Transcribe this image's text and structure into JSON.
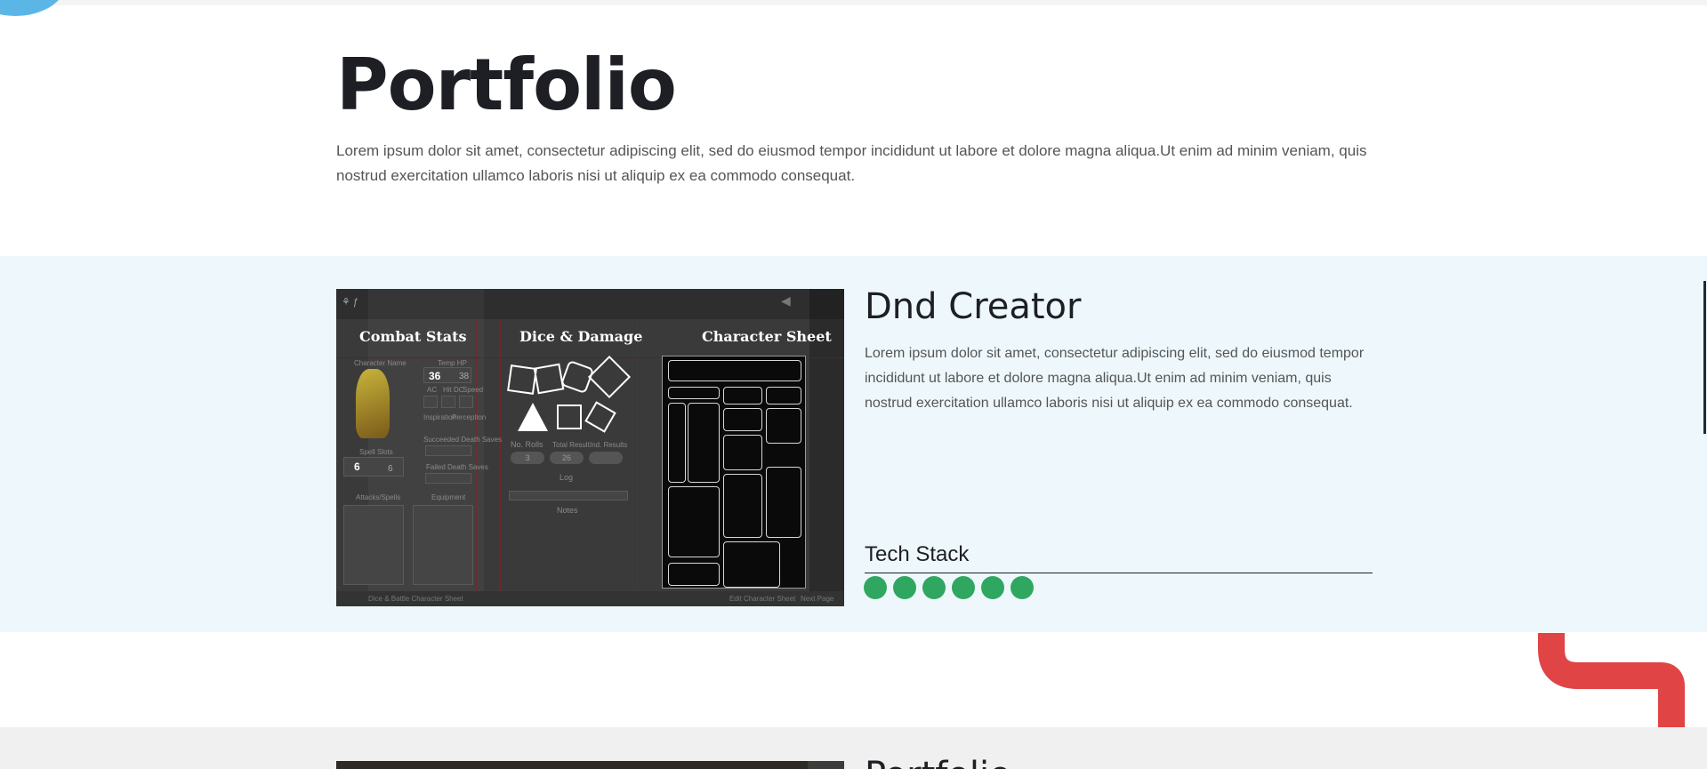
{
  "header": {
    "title": "Portfolio",
    "intro": "Lorem ipsum dolor sit amet, consectetur adipiscing elit, sed do eiusmod tempor incididunt ut labore et dolore magna aliqua.Ut enim ad minim veniam, quis nostrud exercitation ullamco laboris nisi ut aliquip ex ea commodo consequat."
  },
  "projects": [
    {
      "title": "Dnd Creator",
      "description": "Lorem ipsum dolor sit amet, consectetur adipiscing elit, sed do eiusmod tempor incididunt ut labore et dolore magna aliqua.Ut enim ad minim veniam, quis nostrud exercitation ullamco laboris nisi ut aliquip ex ea commodo consequat.",
      "tech_stack_label": "Tech Stack",
      "tech_stack_count": 6,
      "screenshot": {
        "panels": [
          "Combat Stats",
          "Dice & Damage",
          "Character Sheet"
        ],
        "labels": {
          "character_name": "Character Name",
          "temp_hp": "Temp HP",
          "spell_slots": "Spell Slots",
          "attacks_spells": "Attacks/Spells",
          "equipment": "Equipment",
          "no_rolls": "No. Rolls",
          "total_result": "Total Result",
          "ind_results": "Ind. Results",
          "log": "Log",
          "notes": "Notes",
          "ac": "AC",
          "hit_dc": "Hit DC",
          "speed": "Speed",
          "inspiration": "Inspiration",
          "perception": "Perception",
          "succeeded_death_saves": "Succeeded Death Saves",
          "failed_death_saves": "Failed Death Saves"
        },
        "values": {
          "hp_current": "36",
          "hp_max": "38",
          "spell_slot_current": "6",
          "spell_slot_max": "6",
          "rolls": "3",
          "total": "26"
        },
        "footer": [
          "Dice & Battle Character Sheet",
          "Edit Character Sheet",
          "Next Page"
        ]
      }
    },
    {
      "title": "Portfolio"
    }
  ],
  "colors": {
    "accent_blue": "#5bb6e6",
    "tech_dot": "#2fa760",
    "red_hook": "#e04444",
    "band": "#eef8fc"
  }
}
